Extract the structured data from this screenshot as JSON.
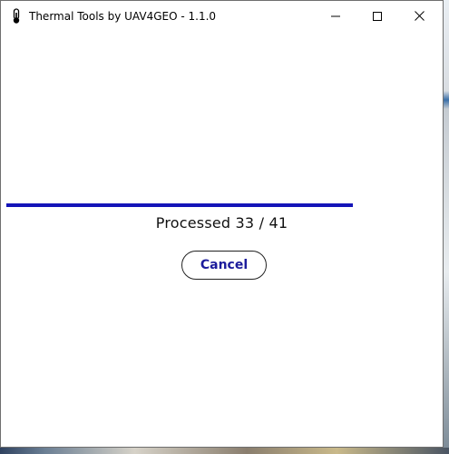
{
  "window": {
    "title": "Thermal Tools by UAV4GEO - 1.1.0",
    "icon": "thermometer-icon",
    "controls": [
      "minimize-icon",
      "maximize-icon",
      "close-icon"
    ]
  },
  "progress": {
    "processed": 33,
    "total": 41,
    "fraction": 0.805,
    "status_text": "Processed 33 / 41",
    "bar_color": "#1414b8"
  },
  "actions": {
    "cancel_label": "Cancel",
    "cancel_color": "#1c1c9c"
  }
}
